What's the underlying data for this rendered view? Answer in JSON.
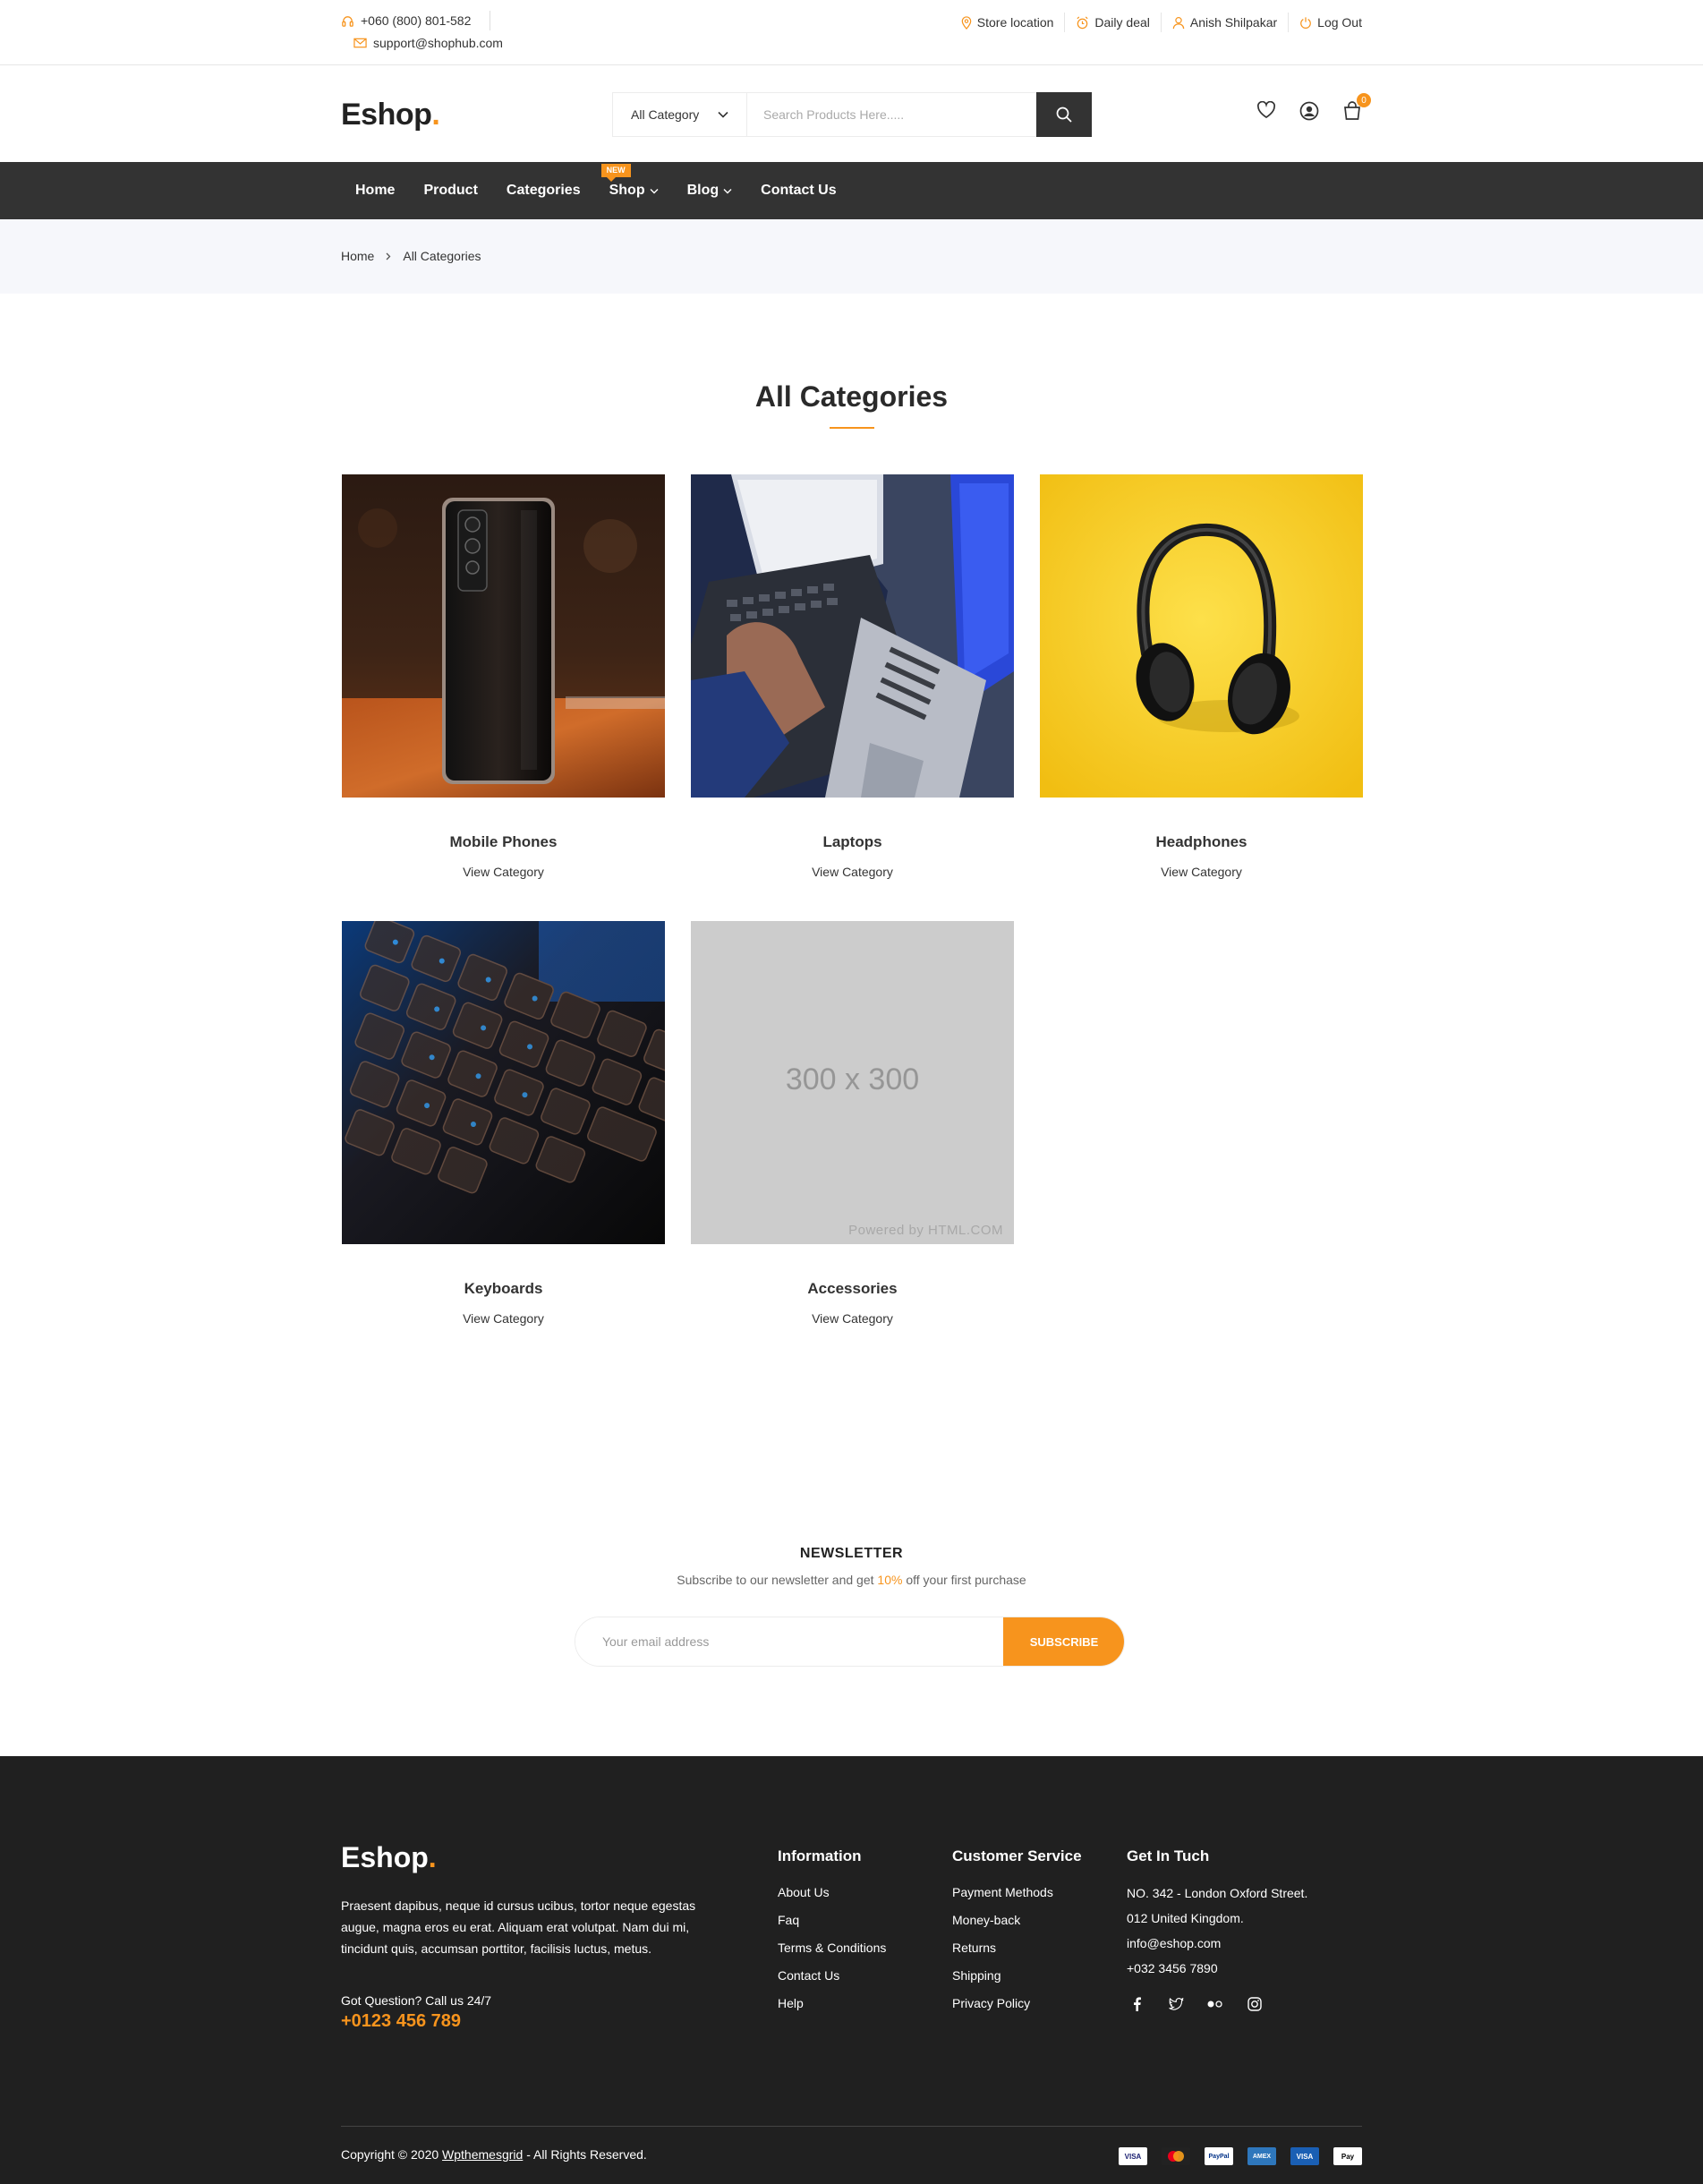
{
  "topbar": {
    "phone": "+060 (800) 801-582",
    "email": "support@shophub.com",
    "links": [
      {
        "label": "Store location",
        "icon": "location-pin-icon"
      },
      {
        "label": "Daily deal",
        "icon": "alarm-clock-icon"
      },
      {
        "label": "Anish Shilpakar",
        "icon": "user-icon"
      },
      {
        "label": "Log Out",
        "icon": "power-icon"
      }
    ]
  },
  "header": {
    "logo_text": "Eshop",
    "logo_dot": ".",
    "category_select": "All Category",
    "search_placeholder": "Search Products Here.....",
    "cart_count": "0"
  },
  "nav": {
    "items": [
      "Home",
      "Product",
      "Categories",
      "Shop",
      "Blog",
      "Contact Us"
    ],
    "new_badge": "NEW"
  },
  "breadcrumb": {
    "home": "Home",
    "current": "All Categories"
  },
  "page_title": "All Categories",
  "categories": [
    {
      "name": "Mobile Phones",
      "link": "View Category"
    },
    {
      "name": "Laptops",
      "link": "View Category"
    },
    {
      "name": "Headphones",
      "link": "View Category"
    },
    {
      "name": "Keyboards",
      "link": "View Category"
    },
    {
      "name": "Accessories",
      "link": "View Category"
    }
  ],
  "placeholder_image": {
    "size_text": "300 x 300",
    "powered_text": "Powered by HTML.COM"
  },
  "newsletter": {
    "title": "NEWSLETTER",
    "sub_before": "Subscribe to our newsletter and get ",
    "sub_highlight": "10%",
    "sub_after": " off your first purchase",
    "placeholder": "Your email address",
    "button": "SUBSCRIBE"
  },
  "footer": {
    "logo_text": "Eshop",
    "logo_dot": ".",
    "about": "Praesent dapibus, neque id cursus ucibus, tortor neque egestas augue, magna eros eu erat. Aliquam erat volutpat. Nam dui mi, tincidunt quis, accumsan porttitor, facilisis luctus, metus.",
    "question": "Got Question? Call us 24/7",
    "phone": "+0123 456 789",
    "information": {
      "title": "Information",
      "links": [
        "About Us",
        "Faq",
        "Terms & Conditions",
        "Contact Us",
        "Help"
      ]
    },
    "customer_service": {
      "title": "Customer Service",
      "links": [
        "Payment Methods",
        "Money-back",
        "Returns",
        "Shipping",
        "Privacy Policy"
      ]
    },
    "contact": {
      "title": "Get In Tuch",
      "lines": [
        "NO. 342 - London Oxford Street.",
        "012 United Kingdom.",
        "info@eshop.com",
        "+032 3456 7890"
      ]
    },
    "social_icons": [
      "facebook-icon",
      "twitter-icon",
      "flickr-icon",
      "instagram-icon"
    ],
    "copyright_before": "Copyright © 2020 ",
    "copyright_link": "Wpthemesgrid",
    "copyright_after": " - All Rights Reserved.",
    "payment_icons": [
      "VISA",
      "mastercard",
      "PayPal",
      "AMEX",
      "VISA",
      "Pay"
    ]
  },
  "colors": {
    "accent": "#f7941d",
    "dark": "#333333",
    "footer": "#202020"
  }
}
